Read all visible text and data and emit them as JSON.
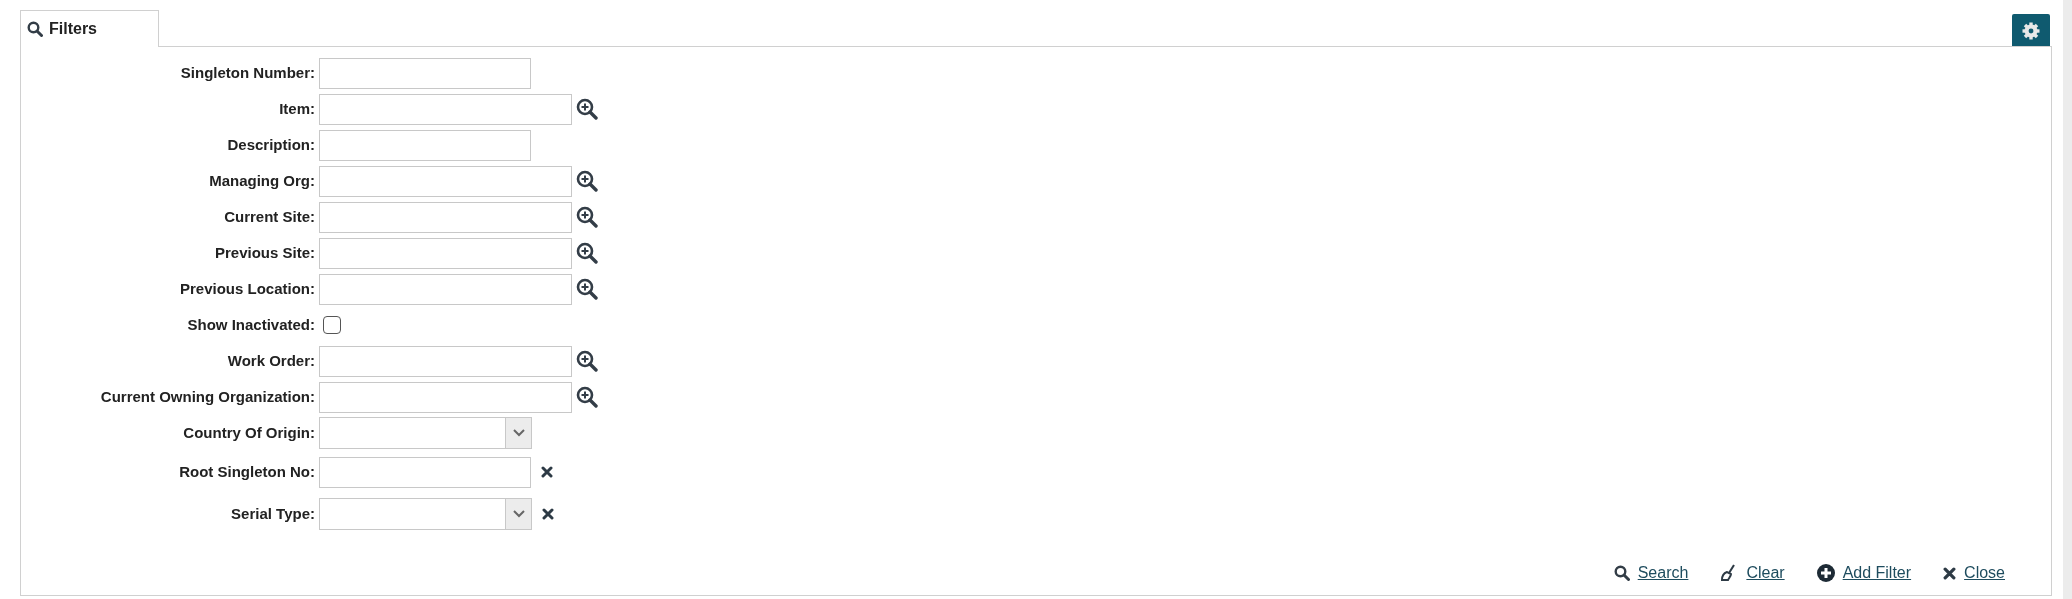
{
  "tab": {
    "label": "Filters",
    "selected": true
  },
  "fields": [
    {
      "label": "Singleton Number:",
      "kind": "text",
      "clearable": false
    },
    {
      "label": "Item:",
      "kind": "lookup",
      "clearable": false
    },
    {
      "label": "Description:",
      "kind": "text",
      "clearable": false
    },
    {
      "label": "Managing Org:",
      "kind": "lookup",
      "clearable": false
    },
    {
      "label": "Current Site:",
      "kind": "lookup",
      "clearable": false
    },
    {
      "label": "Previous Site:",
      "kind": "lookup",
      "clearable": false
    },
    {
      "label": "Previous Location:",
      "kind": "lookup",
      "clearable": false
    },
    {
      "label": "Show Inactivated:",
      "kind": "checkbox",
      "checked": false,
      "clearable": false
    },
    {
      "label": "Work Order:",
      "kind": "lookup",
      "clearable": false
    },
    {
      "label": "Current Owning Organization:",
      "kind": "lookup",
      "clearable": false
    },
    {
      "label": "Country Of Origin:",
      "kind": "select",
      "clearable": false
    },
    {
      "label": "Root Singleton No:",
      "kind": "text",
      "clearable": true
    },
    {
      "label": "Serial Type:",
      "kind": "select",
      "clearable": true
    }
  ],
  "actions": [
    {
      "label": "Search",
      "kind": "search"
    },
    {
      "label": "Clear",
      "kind": "clear"
    },
    {
      "label": "Add Filter",
      "kind": "add"
    },
    {
      "label": "Close",
      "kind": "close"
    }
  ]
}
